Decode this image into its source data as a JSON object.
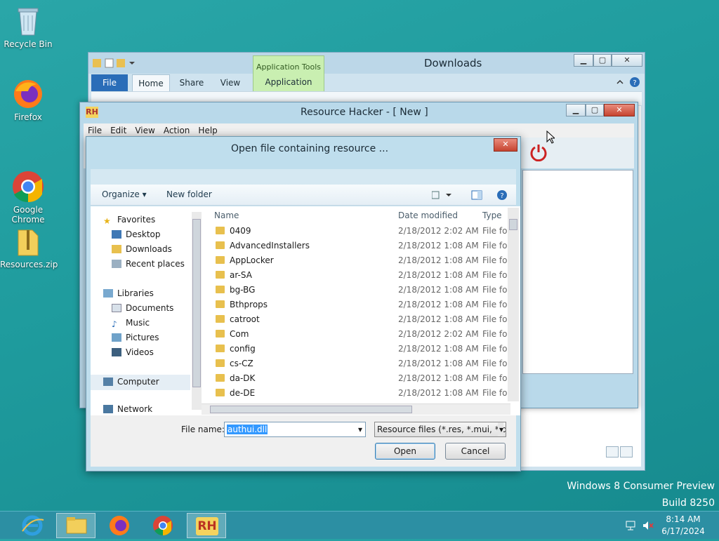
{
  "desktop": {
    "icons": [
      {
        "label": "Recycle Bin"
      },
      {
        "label": "Firefox"
      },
      {
        "label": "Google\nChrome"
      },
      {
        "label": "Resources.zip"
      }
    ],
    "watermark": {
      "line1": "Windows 8 Consumer Preview",
      "line2": "Build 8250"
    }
  },
  "explorer": {
    "title": "Downloads",
    "tool_tab": {
      "group": "Application Tools",
      "tab": "Application"
    },
    "tabs": [
      "File",
      "Home",
      "Share",
      "View"
    ]
  },
  "resource_hacker": {
    "title": "Resource Hacker - [ New ]",
    "menu": [
      "File",
      "Edit",
      "View",
      "Action",
      "Help"
    ]
  },
  "dialog": {
    "title": "Open file containing resource ...",
    "organize": "Organize ▾",
    "new_folder": "New folder",
    "nav": {
      "favorites": "Favorites",
      "desktop": "Desktop",
      "downloads": "Downloads",
      "recent": "Recent places",
      "libraries": "Libraries",
      "documents": "Documents",
      "music": "Music",
      "pictures": "Pictures",
      "videos": "Videos",
      "computer": "Computer",
      "network": "Network"
    },
    "columns": {
      "name": "Name",
      "date": "Date modified",
      "type": "Type"
    },
    "rows": [
      {
        "name": "0409",
        "date": "2/18/2012 2:02 AM",
        "type": "File fol"
      },
      {
        "name": "AdvancedInstallers",
        "date": "2/18/2012 1:08 AM",
        "type": "File fol"
      },
      {
        "name": "AppLocker",
        "date": "2/18/2012 1:08 AM",
        "type": "File fol"
      },
      {
        "name": "ar-SA",
        "date": "2/18/2012 1:08 AM",
        "type": "File fol"
      },
      {
        "name": "bg-BG",
        "date": "2/18/2012 1:08 AM",
        "type": "File fol"
      },
      {
        "name": "Bthprops",
        "date": "2/18/2012 1:08 AM",
        "type": "File fol"
      },
      {
        "name": "catroot",
        "date": "2/18/2012 1:08 AM",
        "type": "File fol"
      },
      {
        "name": "Com",
        "date": "2/18/2012 2:02 AM",
        "type": "File fol"
      },
      {
        "name": "config",
        "date": "2/18/2012 1:08 AM",
        "type": "File fol"
      },
      {
        "name": "cs-CZ",
        "date": "2/18/2012 1:08 AM",
        "type": "File fol"
      },
      {
        "name": "da-DK",
        "date": "2/18/2012 1:08 AM",
        "type": "File fol"
      },
      {
        "name": "de-DE",
        "date": "2/18/2012 1:08 AM",
        "type": "File fol"
      }
    ],
    "file_name_label": "File name:",
    "file_name_value": "authui.dll",
    "filter": "Resource files (*.res, *.mui, *.dll",
    "open": "Open",
    "cancel": "Cancel"
  },
  "taskbar": {
    "time": "8:14 AM",
    "date": "6/17/2024",
    "rh_label": "RH"
  },
  "colors": {
    "accent": "#2a6db8",
    "close": "#c64430",
    "taskbar": "#2c8fa3"
  }
}
